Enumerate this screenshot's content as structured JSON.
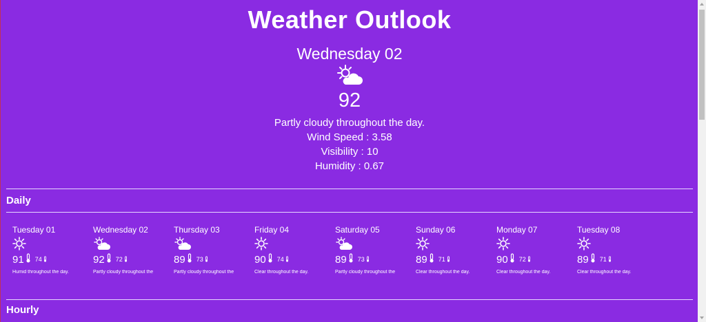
{
  "title": "Weather Outlook",
  "current": {
    "day": "Wednesday 02",
    "icon": "partly-cloudy-day-icon",
    "temp": "92",
    "summary": "Partly cloudy throughout the day.",
    "wind": "Wind Speed : 3.58",
    "visibility": "Visibility : 10",
    "humidity": "Humidity : 0.67"
  },
  "daily_heading": "Daily",
  "days": [
    {
      "name": "Tuesday 01",
      "icon": "sun-icon",
      "hi": "91",
      "lo": "74",
      "summary": "Humid throughout the day."
    },
    {
      "name": "Wednesday 02",
      "icon": "partly-cloudy-day-icon",
      "hi": "92",
      "lo": "72",
      "summary": "Partly cloudy throughout the"
    },
    {
      "name": "Thursday 03",
      "icon": "partly-cloudy-day-icon",
      "hi": "89",
      "lo": "73",
      "summary": "Partly cloudy throughout the"
    },
    {
      "name": "Friday 04",
      "icon": "sun-icon",
      "hi": "90",
      "lo": "74",
      "summary": "Clear throughout the day."
    },
    {
      "name": "Saturday 05",
      "icon": "partly-cloudy-day-icon",
      "hi": "89",
      "lo": "73",
      "summary": "Partly cloudy throughout the"
    },
    {
      "name": "Sunday 06",
      "icon": "sun-icon",
      "hi": "89",
      "lo": "71",
      "summary": "Clear throughout the day."
    },
    {
      "name": "Monday 07",
      "icon": "sun-icon",
      "hi": "90",
      "lo": "72",
      "summary": "Clear throughout the day."
    },
    {
      "name": "Tuesday 08",
      "icon": "sun-icon",
      "hi": "89",
      "lo": "71",
      "summary": "Clear throughout the day."
    }
  ],
  "hourly_heading": "Hourly",
  "colors": {
    "background": "#8a2be2",
    "text": "#ffffff",
    "divider": "#e9d8ff"
  }
}
